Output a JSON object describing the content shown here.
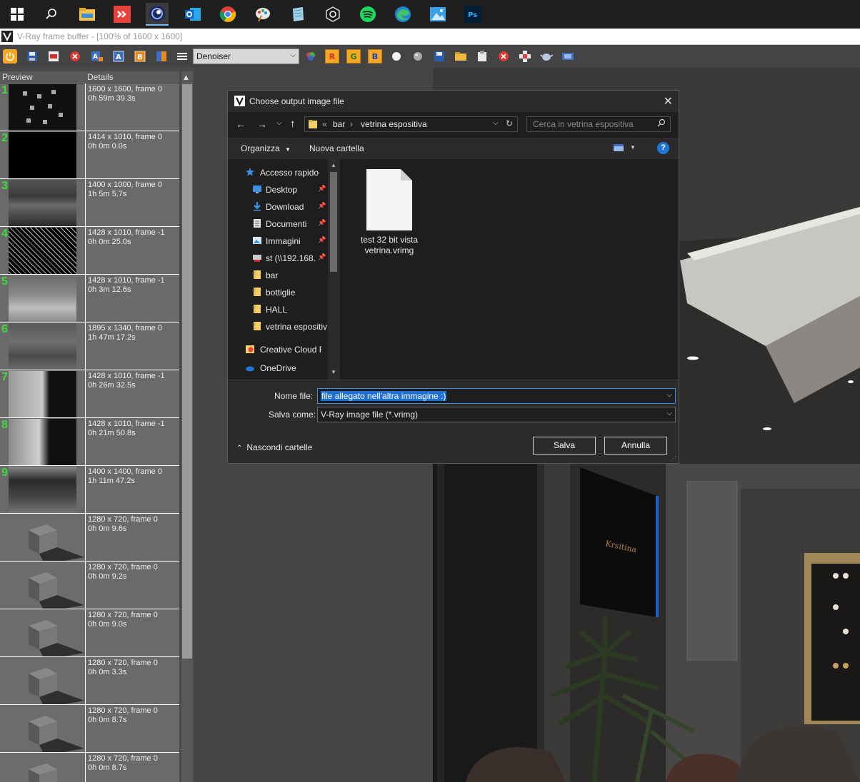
{
  "window": {
    "title": "V-Ray frame buffer - [100% of 1600 x 1600]"
  },
  "taskbar": {
    "icons": [
      "windows-start-icon",
      "search-icon",
      "file-explorer-icon",
      "anydesk-icon",
      "cinema4d-icon",
      "outlook-icon",
      "chrome-icon",
      "paint-icon",
      "notepad-icon",
      "app-icon",
      "spotify-icon",
      "edge-icon",
      "photos-icon",
      "photoshop-icon"
    ]
  },
  "toolbar": {
    "denoiser_select": "Denoiser",
    "rgb_buttons": [
      "R",
      "G",
      "B"
    ],
    "channel_buttons": [
      "A",
      "B"
    ]
  },
  "history": {
    "col_preview": "Preview",
    "col_details": "Details",
    "rows": [
      {
        "num": "1",
        "size": "1600 x 1600, frame 0",
        "time": "0h 59m 39.3s"
      },
      {
        "num": "2",
        "size": "1414 x 1010, frame 0",
        "time": "0h 0m 0.0s"
      },
      {
        "num": "3",
        "size": "1400 x 1000, frame 0",
        "time": "1h 5m 5.7s"
      },
      {
        "num": "4",
        "size": "1428 x 1010, frame -1",
        "time": "0h 0m 25.0s"
      },
      {
        "num": "5",
        "size": "1428 x 1010, frame -1",
        "time": "0h 3m 12.6s"
      },
      {
        "num": "6",
        "size": "1895 x 1340, frame 0",
        "time": "1h 47m 17.2s"
      },
      {
        "num": "7",
        "size": "1428 x 1010, frame -1",
        "time": "0h 26m 32.5s"
      },
      {
        "num": "8",
        "size": "1428 x 1010, frame -1",
        "time": "0h 21m 50.8s"
      },
      {
        "num": "9",
        "size": "1400 x 1400, frame 0",
        "time": "1h 11m 47.2s"
      },
      {
        "num": "",
        "size": "1280 x 720, frame 0",
        "time": "0h 0m 9.6s"
      },
      {
        "num": "",
        "size": "1280 x 720, frame 0",
        "time": "0h 0m 9.2s"
      },
      {
        "num": "",
        "size": "1280 x 720, frame 0",
        "time": "0h 0m 9.0s"
      },
      {
        "num": "",
        "size": "1280 x 720, frame 0",
        "time": "0h 0m 3.3s"
      },
      {
        "num": "",
        "size": "1280 x 720, frame 0",
        "time": "0h 0m 8.7s"
      },
      {
        "num": "",
        "size": "1280 x 720, frame 0",
        "time": "0h 0m 8.7s"
      }
    ]
  },
  "dialog": {
    "title": "Choose output image file",
    "address": {
      "overflow": "«",
      "crumbs": [
        "bar",
        "vetrina espositiva"
      ]
    },
    "search_placeholder": "Cerca in vetrina espositiva",
    "organize": "Organizza",
    "new_folder": "Nuova cartella",
    "help": "?",
    "nav_items": [
      {
        "label": "Accesso rapido",
        "icon": "star-icon",
        "pinned": false
      },
      {
        "label": "Desktop",
        "icon": "desktop-icon",
        "pinned": true
      },
      {
        "label": "Download",
        "icon": "download-icon",
        "pinned": true
      },
      {
        "label": "Documenti",
        "icon": "document-icon",
        "pinned": true
      },
      {
        "label": "Immagini",
        "icon": "pictures-icon",
        "pinned": true
      },
      {
        "label": "st (\\\\192.168.",
        "icon": "network-drive-icon",
        "pinned": true
      },
      {
        "label": "bar",
        "icon": "folder-icon",
        "pinned": false
      },
      {
        "label": "bottiglie",
        "icon": "folder-icon",
        "pinned": false
      },
      {
        "label": "HALL",
        "icon": "folder-icon",
        "pinned": false
      },
      {
        "label": "vetrina espositiva",
        "icon": "folder-icon",
        "pinned": false
      },
      {
        "label": "Creative Cloud Fil",
        "icon": "creative-cloud-icon",
        "pinned": false
      },
      {
        "label": "OneDrive",
        "icon": "onedrive-icon",
        "pinned": false
      }
    ],
    "file": {
      "name_line1": "test 32 bit vista",
      "name_line2": "vetrina.vrimg"
    },
    "filename_label": "Nome file:",
    "filename_value": "file allegato nell'altra immagine :)",
    "savetype_label": "Salva come:",
    "savetype_value": "V-Ray image file (*.vrimg)",
    "hide_folders": "Nascondi cartelle",
    "save_btn": "Salva",
    "cancel_btn": "Annulla"
  },
  "render": {
    "sign_text": "Krsitina"
  }
}
